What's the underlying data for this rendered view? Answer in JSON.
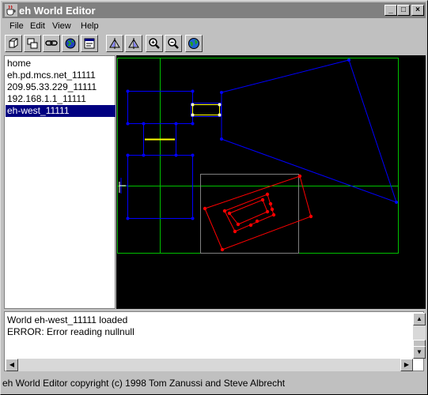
{
  "window": {
    "title": "eh World Editor"
  },
  "title_buttons": [
    "_",
    "□",
    "×"
  ],
  "menu": [
    {
      "label": "File"
    },
    {
      "label": "Edit"
    },
    {
      "label": "View"
    },
    {
      "label": "Help"
    }
  ],
  "toolbar": [
    {
      "icon": "cube-icon"
    },
    {
      "icon": "boxes-icon"
    },
    {
      "icon": "link-icon"
    },
    {
      "icon": "globe-icon"
    },
    {
      "icon": "properties-icon"
    },
    {
      "icon": "triangle-icon"
    },
    {
      "icon": "triangle-alt-icon"
    },
    {
      "icon": "zoom-in-icon"
    },
    {
      "icon": "zoom-out-icon"
    },
    {
      "icon": "world-icon"
    }
  ],
  "server_list": {
    "items": [
      "home",
      "eh.pd.mcs.net_11111",
      "209.95.33.229_11111",
      "192.168.1.1_11111",
      "eh-west_11111"
    ],
    "selected": "eh-west_11111"
  },
  "log": {
    "lines": [
      "World eh-west_11111 loaded",
      "ERROR: Error reading nullnull"
    ]
  },
  "status": {
    "text": "eh World Editor copyright (c) 1998 Tom Zanussi and Steve Albrecht"
  },
  "colors": {
    "canvas_bg": "#000000",
    "grid": "#00c000",
    "room": "#0000ff",
    "selected_room": "#ff0000",
    "highlight_edge": "#ffff00",
    "zone": "#808080",
    "selection_bg": "#000080"
  }
}
